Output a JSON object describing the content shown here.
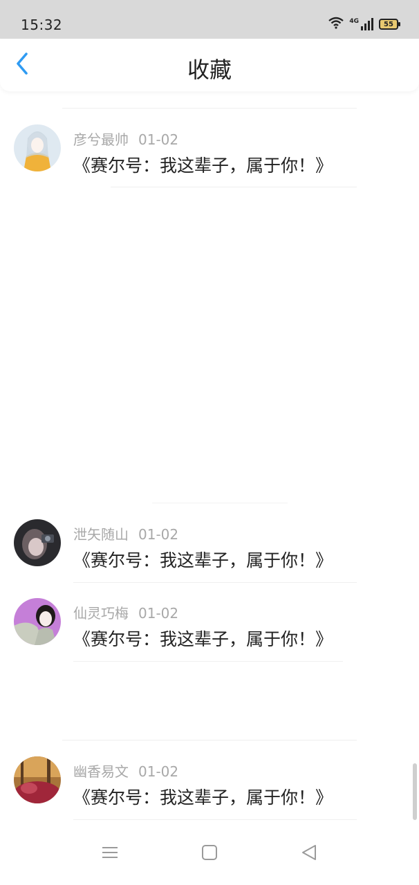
{
  "status_bar": {
    "time": "15:32",
    "network": "4G",
    "battery": "55",
    "icons": [
      "wifi-icon",
      "signal-icon",
      "battery-icon"
    ]
  },
  "header": {
    "title": "收藏",
    "back_icon": "chevron-left-icon",
    "accent_color": "#2f9bf2"
  },
  "favorites": [
    {
      "author": "彦兮最帅",
      "date": "01-02",
      "title": "《赛尔号：我这辈子，属于你！》"
    },
    {
      "author": "泄矢随山",
      "date": "01-02",
      "title": "《赛尔号：我这辈子，属于你！》"
    },
    {
      "author": "仙灵巧梅",
      "date": "01-02",
      "title": "《赛尔号：我这辈子，属于你！》"
    },
    {
      "author": "幽香易文",
      "date": "01-02",
      "title": "《赛尔号：我这辈子，属于你！》"
    }
  ],
  "nav_bar": {
    "icons": [
      "menu-icon",
      "home-icon",
      "back-triangle-icon"
    ]
  }
}
